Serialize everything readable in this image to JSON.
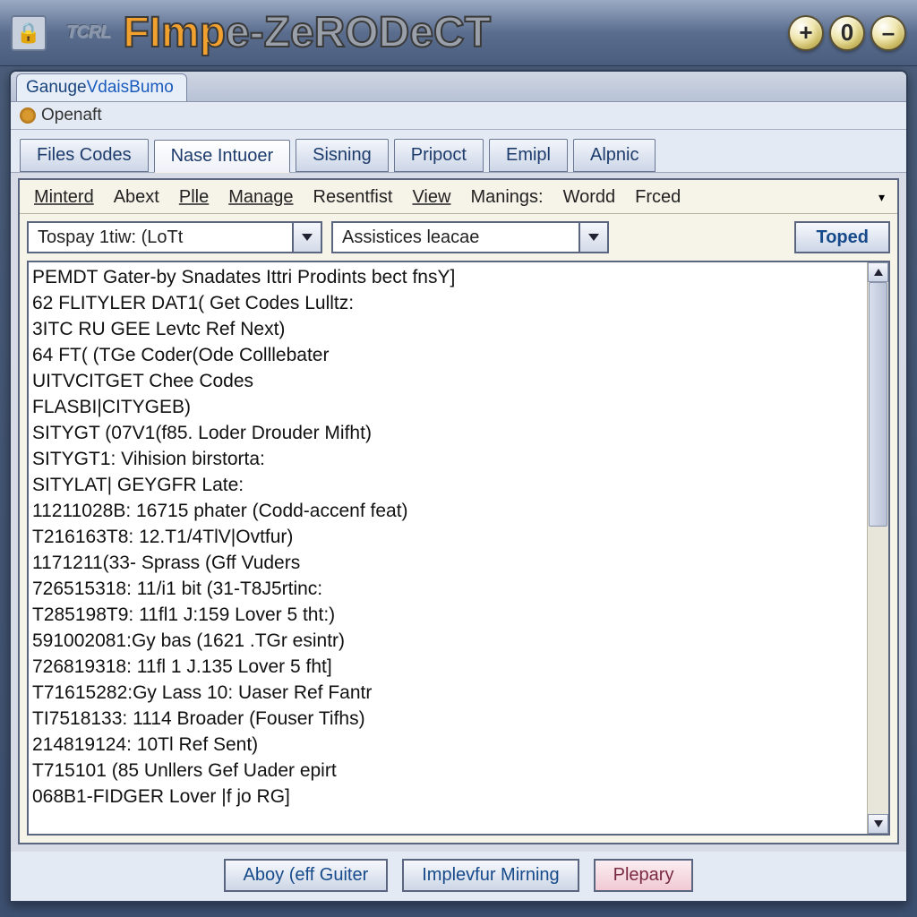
{
  "title": {
    "emblem": "TCRL",
    "seg1": "FImp",
    "seg2": "e-ZeRODeCT"
  },
  "titlebar_buttons": {
    "plus": "+",
    "zero": "0",
    "minus": "–"
  },
  "window_tab": {
    "pre": "Ganuge ",
    "mid": "Vdais",
    "post": " Bumo"
  },
  "subtitle": "Openaft",
  "tabs": [
    "Files Codes",
    "Nase Intuoer",
    "Sisning",
    "Pripoct",
    "Emipl",
    "Alpnic"
  ],
  "menubar": [
    "Minterd",
    "Abext",
    "Plle",
    "Manage",
    "Resentfist",
    "View",
    "Manings:",
    "Wordd",
    "Frced"
  ],
  "toolbar": {
    "combo1": "Tospay 1tiw: (LoTt",
    "combo2": "Assistices leacae",
    "toped": "Toped"
  },
  "list": [
    "PEMDT Gater-by Snadates Ittri Prodints bect fnsY]",
    "62  FLITYLER DAT1( Get Codes Lulltz:",
    "3ITC RU GEE Levtc Ref Next)",
    "64  FT( (TGe Coder(Ode Colllebater",
    "UITVCITGET Chee Codes",
    "FLASBI|CITYGEB)",
    "SITYGT (07V1(f85. Loder Drouder Mifht)",
    "SITYGT1: Vihision birstorta:",
    "SITYLAT| GEYGFR Late:",
    "11211028B: 16715 phater (Codd-accenf feat)",
    "T216163T8: 12.T1/4TlV|Ovtfur)",
    "1171211(33- Sprass (Gff Vuders",
    "726515318: 11/i1 bit (31-T8J5rtinc:",
    "T285198T9: 11fl1 J:159 Lover 5 tht:)",
    "591002081:Gy bas (1621 .TGr esintr)",
    "726819318: 11fl 1 J.135 Lover 5 fht]",
    "T71615282:Gy Lass 10: Uaser Ref Fantr",
    "TI7518133: 1114 Broader (Fouser Tifhs)",
    "214819124: 10Tl Ref Sent)",
    "T715101 (85 Unllers Gef Uader epirt",
    "068B1-FIDGER Lover |f jo RG]"
  ],
  "footer": {
    "aboy": "Aboy (eff Guiter",
    "imple": "Implevfur Mirning",
    "plepary": "Plepary"
  }
}
